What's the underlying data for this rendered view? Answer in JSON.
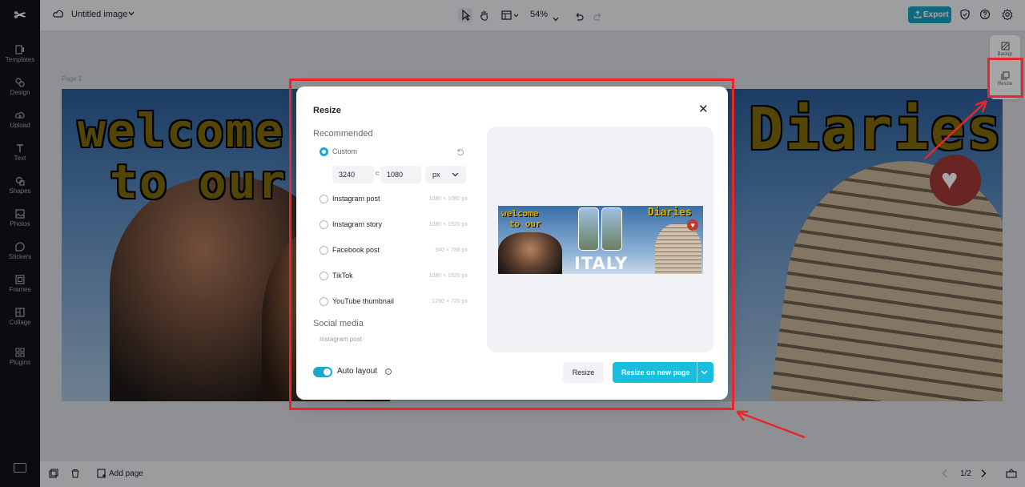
{
  "app": {
    "doc_title": "Untitled image",
    "zoom": "54%",
    "export_label": "Export",
    "page_label": "Page 1"
  },
  "left_rail": {
    "items": [
      {
        "label": "Templates",
        "icon": "templates-icon"
      },
      {
        "label": "Design",
        "icon": "design-icon"
      },
      {
        "label": "Upload",
        "icon": "upload-icon"
      },
      {
        "label": "Text",
        "icon": "text-icon"
      },
      {
        "label": "Shapes",
        "icon": "shapes-icon"
      },
      {
        "label": "Photos",
        "icon": "photos-icon"
      },
      {
        "label": "Stickers",
        "icon": "stickers-icon"
      },
      {
        "label": "Frames",
        "icon": "frames-icon"
      },
      {
        "label": "Collage",
        "icon": "collage-icon"
      },
      {
        "label": "Plugins",
        "icon": "plugins-icon"
      }
    ]
  },
  "right_panel": {
    "items": [
      {
        "label": "Backgr",
        "icon": "background-icon"
      },
      {
        "label": "Resize",
        "icon": "resize-icon"
      }
    ]
  },
  "design": {
    "welcome_line1": "welcome",
    "welcome_line2": "to our",
    "diaries": "Diaries",
    "italy": "ITALY"
  },
  "dialog": {
    "title": "Resize",
    "recommended_heading": "Recommended",
    "custom_label": "Custom",
    "width_value": "3240",
    "height_value": "1080",
    "unit": "px",
    "options": [
      {
        "label": "Instagram post",
        "dims": "1080 × 1080 px"
      },
      {
        "label": "Instagram story",
        "dims": "1080 × 1920 px"
      },
      {
        "label": "Facebook post",
        "dims": "940 × 788 px"
      },
      {
        "label": "TikTok",
        "dims": "1080 × 1920 px"
      },
      {
        "label": "YouTube thumbnail",
        "dims": "1280 × 720 px"
      }
    ],
    "social_heading": "Social media",
    "social_item": "Instagram post",
    "auto_layout_label": "Auto layout",
    "resize_button": "Resize",
    "resize_new_page_button": "Resize on new page"
  },
  "bottom": {
    "add_page": "Add page",
    "page_counter": "1/2"
  },
  "colors": {
    "accent": "#19bde0",
    "export": "#18a4c7",
    "annotation": "#e8262b"
  }
}
